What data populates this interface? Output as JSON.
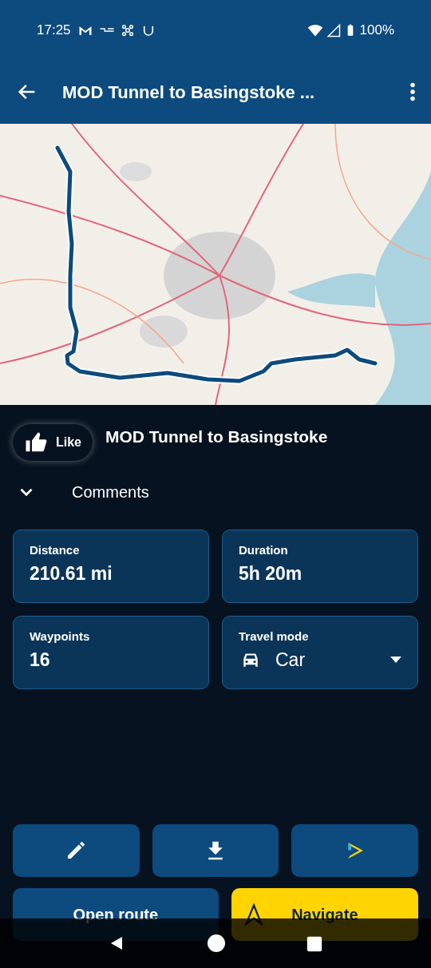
{
  "status_bar": {
    "time": "17:25",
    "battery": "100%"
  },
  "app_bar": {
    "title": "MOD Tunnel to Basingstoke ..."
  },
  "route": {
    "title": "MOD Tunnel to Basingstoke",
    "like_label": "Like"
  },
  "comments": {
    "label": "Comments",
    "expanded": false
  },
  "stats": [
    {
      "label": "Distance",
      "value": "210.61 mi",
      "kind": "text"
    },
    {
      "label": "Duration",
      "value": "5h 20m",
      "kind": "text"
    },
    {
      "label": "Waypoints",
      "value": "16",
      "kind": "text"
    },
    {
      "label": "Travel mode",
      "value": "Car",
      "kind": "dropdown"
    }
  ],
  "actions": [
    {
      "kind": "edit"
    },
    {
      "kind": "download"
    },
    {
      "kind": "share"
    }
  ],
  "bottom_buttons": [
    {
      "label": "Open route",
      "kind": "secondary"
    },
    {
      "label": "Navigate",
      "kind": "primary"
    }
  ]
}
